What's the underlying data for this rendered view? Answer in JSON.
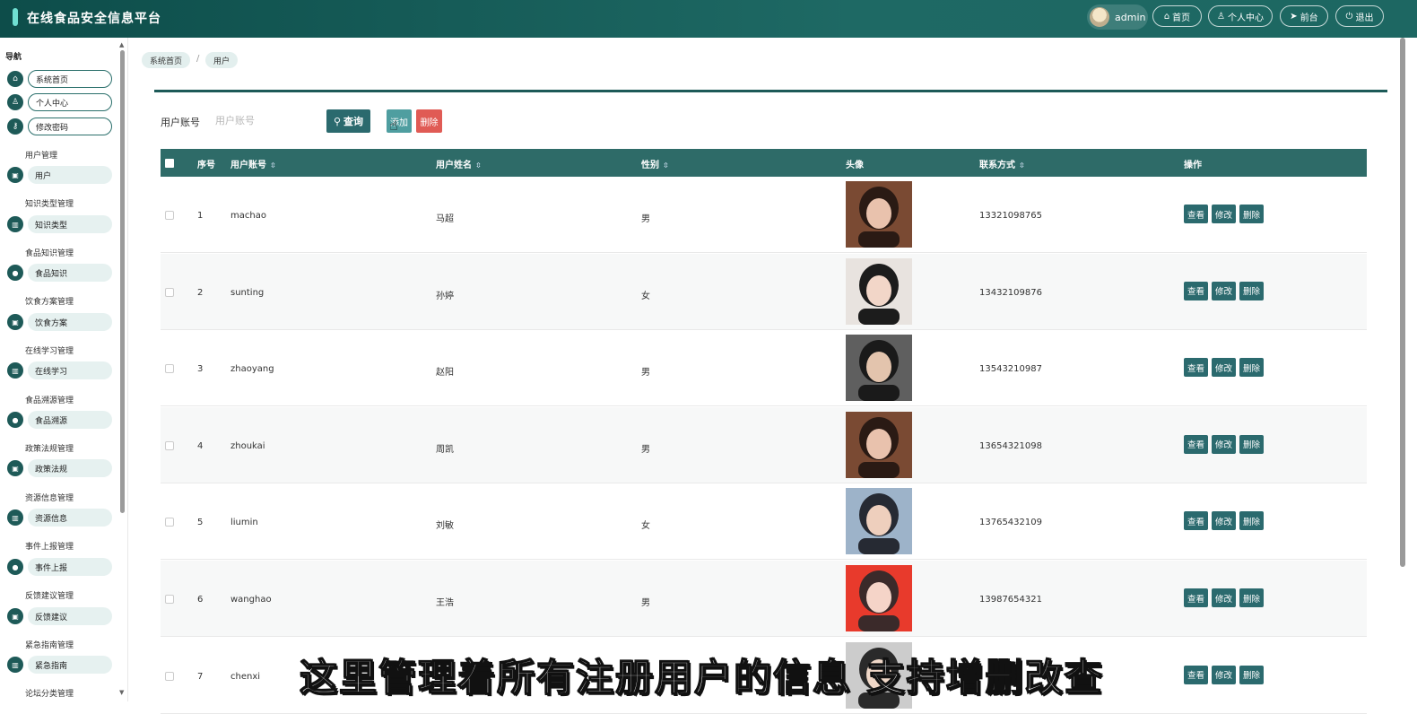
{
  "app": {
    "title": "在线食品安全信息平台"
  },
  "topbar": {
    "user_name": "admin",
    "buttons": [
      {
        "icon": "home-icon",
        "label": "首页"
      },
      {
        "icon": "person-icon",
        "label": "个人中心"
      },
      {
        "icon": "send-icon",
        "label": "前台"
      },
      {
        "icon": "power-icon",
        "label": "退出"
      }
    ]
  },
  "sidebar": {
    "nav_title": "导航",
    "top_items": [
      {
        "icon": "home-icon",
        "label": "系统首页"
      },
      {
        "icon": "person-icon",
        "label": "个人中心"
      },
      {
        "icon": "key-icon",
        "label": "修改密码"
      }
    ],
    "groups": [
      {
        "title": "用户管理",
        "item": "用户",
        "icon": "briefcase-icon"
      },
      {
        "title": "知识类型管理",
        "item": "知识类型",
        "icon": "bar-chart-icon"
      },
      {
        "title": "食品知识管理",
        "item": "食品知识",
        "icon": "map-pin-icon"
      },
      {
        "title": "饮食方案管理",
        "item": "饮食方案",
        "icon": "briefcase-icon"
      },
      {
        "title": "在线学习管理",
        "item": "在线学习",
        "icon": "bar-chart-icon"
      },
      {
        "title": "食品溯源管理",
        "item": "食品溯源",
        "icon": "map-pin-icon"
      },
      {
        "title": "政策法规管理",
        "item": "政策法规",
        "icon": "briefcase-icon"
      },
      {
        "title": "资源信息管理",
        "item": "资源信息",
        "icon": "bar-chart-icon"
      },
      {
        "title": "事件上报管理",
        "item": "事件上报",
        "icon": "map-pin-icon"
      },
      {
        "title": "反馈建议管理",
        "item": "反馈建议",
        "icon": "briefcase-icon"
      },
      {
        "title": "紧急指南管理",
        "item": "紧急指南",
        "icon": "bar-chart-icon"
      },
      {
        "title": "论坛分类管理",
        "item": "",
        "icon": ""
      }
    ]
  },
  "breadcrumb": {
    "home": "系统首页",
    "separator": "/",
    "current": "用户"
  },
  "search": {
    "label": "用户账号",
    "placeholder": "用户账号",
    "query_label": "查询",
    "add_label": "添加",
    "delete_label": "删除"
  },
  "table": {
    "headers": [
      "序号",
      "用户账号",
      "用户姓名",
      "性别",
      "头像",
      "联系方式",
      "操作"
    ],
    "action_labels": [
      "查看",
      "修改",
      "删除"
    ],
    "rows": [
      {
        "index": "1",
        "account": "machao",
        "name": "马超",
        "gender": "男",
        "phone": "13321098765"
      },
      {
        "index": "2",
        "account": "sunting",
        "name": "孙婷",
        "gender": "女",
        "phone": "13432109876"
      },
      {
        "index": "3",
        "account": "zhaoyang",
        "name": "赵阳",
        "gender": "男",
        "phone": "13543210987"
      },
      {
        "index": "4",
        "account": "zhoukai",
        "name": "周凯",
        "gender": "男",
        "phone": "13654321098"
      },
      {
        "index": "5",
        "account": "liumin",
        "name": "刘敏",
        "gender": "女",
        "phone": "13765432109"
      },
      {
        "index": "6",
        "account": "wanghao",
        "name": "王浩",
        "gender": "男",
        "phone": "13987654321"
      },
      {
        "index": "7",
        "account": "chenxi",
        "name": "",
        "gender": "",
        "phone": ""
      }
    ]
  },
  "caption": "这里管理着所有注册用户的信息 支持增删改查",
  "colors": {
    "topbar": "#1e6964",
    "accent": "#2b6a6e",
    "danger": "#e05b55",
    "add": "#4f9ea0"
  }
}
